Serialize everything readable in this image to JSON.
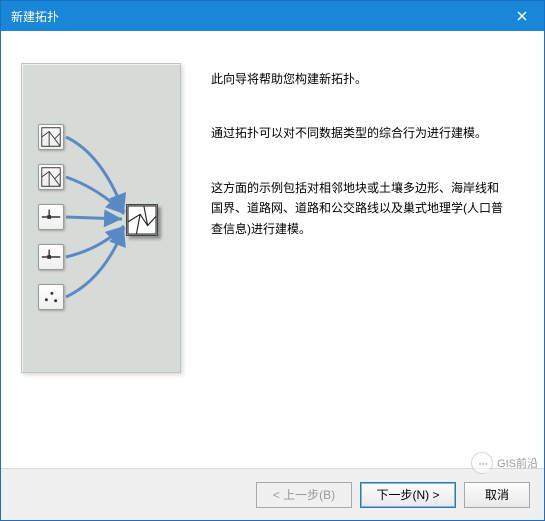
{
  "window": {
    "title": "新建拓扑"
  },
  "body": {
    "p1": "此向导将帮助您构建新拓扑。",
    "p2": "通过拓扑可以对不同数据类型的综合行为进行建模。",
    "p3": "这方面的示例包括对相邻地块或土壤多边形、海岸线和国界、道路网、道路和公交路线以及巢式地理学(人口普查信息)进行建模。"
  },
  "buttons": {
    "back": "< 上一步(B)",
    "next": "下一步(N) >",
    "cancel": "取消"
  },
  "watermark": "GIS前沿",
  "icons": {
    "close": "close-icon",
    "src1": "polygon-features-icon",
    "src2": "polygon-features-icon",
    "src3": "line-node-icon",
    "src4": "line-node-icon",
    "src5": "points-icon",
    "target": "topology-result-icon"
  }
}
